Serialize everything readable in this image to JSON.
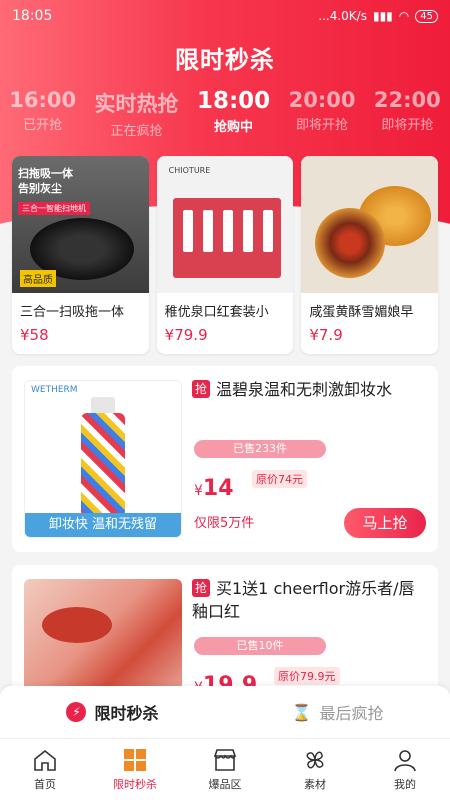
{
  "status": {
    "time": "18:05",
    "network": "...4.0K/s",
    "battery": "45"
  },
  "page_title": "限时秒杀",
  "time_tabs": [
    {
      "time": "16:00",
      "status": "已开抢"
    },
    {
      "time": "实时热抢",
      "status": "正在疯抢"
    },
    {
      "time": "18:00",
      "status": "抢购中"
    },
    {
      "time": "20:00",
      "status": "即将开抢"
    },
    {
      "time": "22:00",
      "status": "即将开抢"
    }
  ],
  "featured": [
    {
      "name": "三合一扫吸拖一体",
      "price": "¥58",
      "img_text": {
        "tag1": "扫拖吸一体",
        "tag2": "告别灰尘",
        "red": "三合一智能扫地机",
        "yellow": "高品质"
      }
    },
    {
      "name": "稚优泉口红套装小",
      "price": "¥79.9",
      "img_text": {
        "brand": "CHIOTURE"
      }
    },
    {
      "name": "咸蛋黄酥雪媚娘早",
      "price": "¥7.9"
    }
  ],
  "items": [
    {
      "badge": "抢",
      "title": "温碧泉温和无刺激卸妆水",
      "sold": "已售233件",
      "currency": "¥",
      "price": "14",
      "orig": "原价74元",
      "limit": "仅限5万件",
      "buy": "马上抢",
      "thumb_brand": "WETHERM",
      "thumb_strip": "卸妆快 温和无残留"
    },
    {
      "badge": "抢",
      "title": "买1送1 cheerflor游乐者/唇釉口红",
      "sold": "已售10件",
      "currency": "¥",
      "price": "19.9",
      "orig": "原价79.9元"
    }
  ],
  "subtabs": [
    {
      "label": "限时秒杀",
      "icon": "bolt-icon"
    },
    {
      "label": "最后疯抢",
      "icon": "hourglass-icon"
    }
  ],
  "nav": [
    {
      "label": "首页",
      "icon": "home-icon"
    },
    {
      "label": "限时秒杀",
      "icon": "grid-icon"
    },
    {
      "label": "爆品区",
      "icon": "store-icon"
    },
    {
      "label": "素材",
      "icon": "pinwheel-icon"
    },
    {
      "label": "我的",
      "icon": "user-icon"
    }
  ],
  "colors": {
    "accent": "#e8244b",
    "hero_start": "#ff6a76",
    "hero_end": "#ef1d3a"
  }
}
